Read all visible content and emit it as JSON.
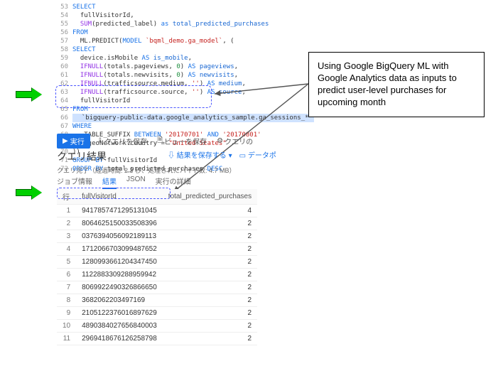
{
  "code": {
    "lines": [
      {
        "n": 53,
        "seg": [
          {
            "c": "kw",
            "t": "SELECT"
          }
        ]
      },
      {
        "n": 54,
        "seg": [
          {
            "c": "id",
            "t": "  fullVisitorId,"
          }
        ]
      },
      {
        "n": 55,
        "seg": [
          {
            "c": "fn",
            "t": "  SUM"
          },
          {
            "c": "id",
            "t": "(predicted_label) "
          },
          {
            "c": "kw",
            "t": "as"
          },
          {
            "c": "ag",
            "t": " total_predicted_purchases"
          }
        ]
      },
      {
        "n": 56,
        "seg": [
          {
            "c": "kw",
            "t": "FROM"
          }
        ]
      },
      {
        "n": 57,
        "seg": [
          {
            "c": "id",
            "t": "  ML.PREDICT("
          },
          {
            "c": "kw",
            "t": "MODEL"
          },
          {
            "c": "str",
            "t": " `bqml_demo.ga_model`"
          },
          {
            "c": "id",
            "t": ", ("
          }
        ]
      },
      {
        "n": 58,
        "seg": [
          {
            "c": "kw",
            "t": "SELECT"
          }
        ]
      },
      {
        "n": 59,
        "seg": [
          {
            "c": "id",
            "t": "  device.isMobile "
          },
          {
            "c": "kw",
            "t": "AS"
          },
          {
            "c": "ag",
            "t": " is_mobile"
          },
          {
            "c": "id",
            "t": ","
          }
        ]
      },
      {
        "n": 60,
        "seg": [
          {
            "c": "fn",
            "t": "  IFNULL"
          },
          {
            "c": "id",
            "t": "(totals.pageviews, "
          },
          {
            "c": "num",
            "t": "0"
          },
          {
            "c": "id",
            "t": ") "
          },
          {
            "c": "kw",
            "t": "AS"
          },
          {
            "c": "ag",
            "t": " pageviews"
          },
          {
            "c": "id",
            "t": ","
          }
        ]
      },
      {
        "n": 61,
        "seg": [
          {
            "c": "fn",
            "t": "  IFNULL"
          },
          {
            "c": "id",
            "t": "(totals.newvisits, "
          },
          {
            "c": "num",
            "t": "0"
          },
          {
            "c": "id",
            "t": ") "
          },
          {
            "c": "kw",
            "t": "AS"
          },
          {
            "c": "ag",
            "t": " newvisits"
          },
          {
            "c": "id",
            "t": ","
          }
        ]
      },
      {
        "n": 62,
        "seg": [
          {
            "c": "fn",
            "t": "  IFNULL"
          },
          {
            "c": "id",
            "t": "(trafficsource.medium, "
          },
          {
            "c": "str",
            "t": "''"
          },
          {
            "c": "id",
            "t": ") "
          },
          {
            "c": "kw",
            "t": "AS"
          },
          {
            "c": "ag",
            "t": " medium"
          },
          {
            "c": "id",
            "t": ","
          }
        ]
      },
      {
        "n": 63,
        "seg": [
          {
            "c": "fn",
            "t": "  IFNULL"
          },
          {
            "c": "id",
            "t": "(trafficsource.source, "
          },
          {
            "c": "str",
            "t": "''"
          },
          {
            "c": "id",
            "t": ") "
          },
          {
            "c": "kw",
            "t": "AS"
          },
          {
            "c": "ag",
            "t": " source"
          },
          {
            "c": "id",
            "t": ","
          }
        ]
      },
      {
        "n": 64,
        "seg": [
          {
            "c": "id",
            "t": "  fullVisitorId"
          }
        ]
      },
      {
        "n": 65,
        "seg": [
          {
            "c": "kw",
            "t": "FROM"
          }
        ]
      },
      {
        "n": 66,
        "seg": [
          {
            "c": "hl",
            "t": "  `bigquery-public-data.google_analytics_sample.ga_sessions_*`"
          }
        ]
      },
      {
        "n": 67,
        "seg": [
          {
            "c": "kw",
            "t": "WHERE"
          }
        ]
      },
      {
        "n": 68,
        "seg": [
          {
            "c": "id",
            "t": "  _TABLE_SUFFIX "
          },
          {
            "c": "kw",
            "t": "BETWEEN"
          },
          {
            "c": "str",
            "t": " '20170701'"
          },
          {
            "c": "kw",
            "t": " AND"
          },
          {
            "c": "str",
            "t": " '20170801'"
          }
        ]
      },
      {
        "n": 69,
        "seg": [
          {
            "c": "kw",
            "t": "AND"
          },
          {
            "c": "id",
            "t": " geoNetwork.country = "
          },
          {
            "c": "str",
            "t": "\"United States\""
          }
        ]
      },
      {
        "n": 70,
        "seg": [
          {
            "c": "id",
            "t": "))"
          }
        ]
      },
      {
        "n": 71,
        "seg": [
          {
            "c": "kw",
            "t": "GROUP BY"
          },
          {
            "c": "id",
            "t": " fullVisitorId"
          }
        ]
      },
      {
        "n": 72,
        "seg": [
          {
            "c": "kw",
            "t": "ORDER BY"
          },
          {
            "c": "id",
            "t": " total_predicted_purchases "
          },
          {
            "c": "kw",
            "t": "DESC"
          }
        ]
      }
    ]
  },
  "toolbar": {
    "run": "実行",
    "save_query": "クエリを保存",
    "save_view": "ビューを保存",
    "query_more": "クエリの"
  },
  "results": {
    "title": "クエリ結果",
    "save_results": "結果を保存する",
    "dataport": "データポ"
  },
  "status": "クエリ完了（経過時間: 2.3 秒、処理されたバイト数: 4.7 MB）",
  "tabs": {
    "job": "ジョブ情報",
    "results": "結果",
    "json": "JSON",
    "exec": "実行の詳細"
  },
  "table": {
    "headers": {
      "row": "行",
      "col1": "fullVisitorId",
      "col2": "total_predicted_purchases"
    },
    "rows": [
      {
        "i": 1,
        "v": "9417857471295131045",
        "p": 4
      },
      {
        "i": 2,
        "v": "8064625150033508396",
        "p": 2
      },
      {
        "i": 3,
        "v": "0376394056092189113",
        "p": 2
      },
      {
        "i": 4,
        "v": "1712066703099487652",
        "p": 2
      },
      {
        "i": 5,
        "v": "1280993661204347450",
        "p": 2
      },
      {
        "i": 6,
        "v": "1122883309288959942",
        "p": 2
      },
      {
        "i": 7,
        "v": "8069922490326866650",
        "p": 2
      },
      {
        "i": 8,
        "v": "3682062203497169",
        "p": 2
      },
      {
        "i": 9,
        "v": "2105122376016897629",
        "p": 2
      },
      {
        "i": 10,
        "v": "4890384027656840003",
        "p": 2
      },
      {
        "i": 11,
        "v": "2969418676126258798",
        "p": 2
      }
    ]
  },
  "callout": "Using Google BigQuery ML with Google Analytics data as inputs to predict user-level purchases for upcoming month"
}
